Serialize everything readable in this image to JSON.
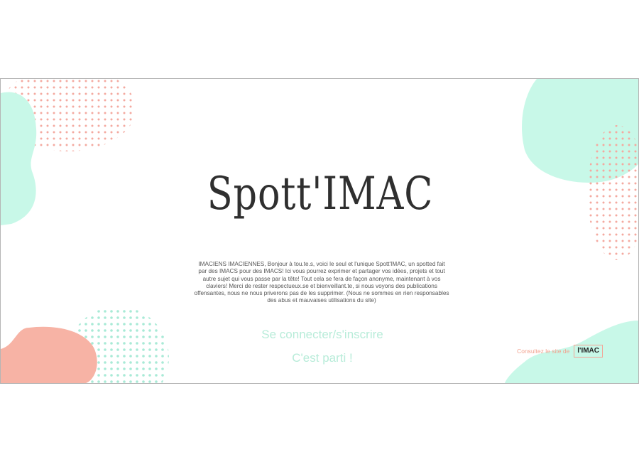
{
  "app": {
    "title": "Spott'IMAC",
    "description": "IMACIENS IMACIENNES, Bonjour à tou.te.s, voici le seul et l'unique Spott'IMAC, un spotted fait par des IMACS pour des IMACS! Ici vous pourrez exprimer et partager vos idées, projets et tout autre sujet qui vous passe par la tête! Tout cela se fera de façon anonyme, maintenant à vos claviers! Merci de rester respectueux.se et bienveillant.te, si nous voyons des publications offensantes, nous ne nous priverons pas de les supprimer. (Nous ne sommes en rien responsables des abus et mauvaises utilisations du site)"
  },
  "actions": {
    "login_label": "Se connecter/s'inscrire",
    "start_label": "C'est parti !"
  },
  "footer": {
    "imac_prefix": "Consultez le site de",
    "imac_logo": "l'IMAC"
  },
  "colors": {
    "mint": "#c8f8e8",
    "salmon": "#f7b3a5",
    "dot_pink": "#f4a9a0",
    "dot_mint": "#a8ead6",
    "title": "#2f2f2f",
    "button_text": "#b8ecd9"
  }
}
